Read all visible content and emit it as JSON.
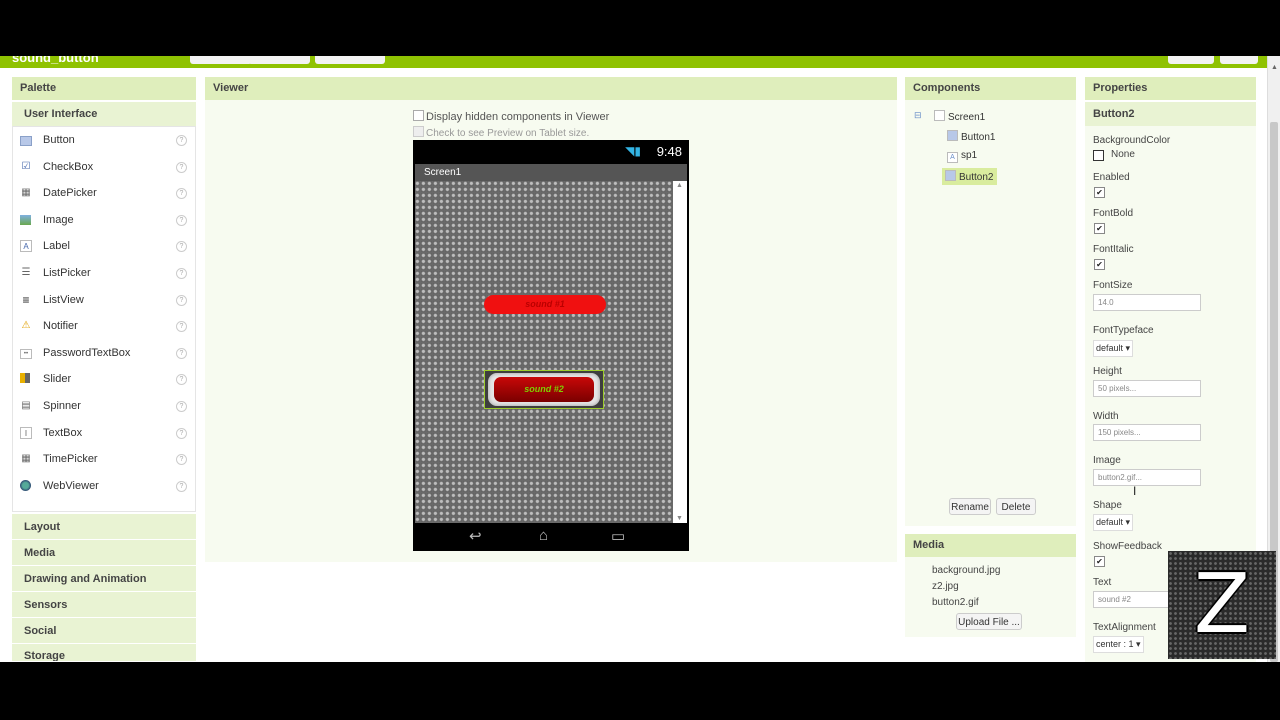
{
  "project": {
    "name": "sound_button"
  },
  "palette": {
    "header": "Palette",
    "section": "User Interface",
    "items": [
      {
        "label": "Button",
        "icon": "button-icon"
      },
      {
        "label": "CheckBox",
        "icon": "checkbox-icon"
      },
      {
        "label": "DatePicker",
        "icon": "datepicker-icon"
      },
      {
        "label": "Image",
        "icon": "image-icon"
      },
      {
        "label": "Label",
        "icon": "label-icon"
      },
      {
        "label": "ListPicker",
        "icon": "listpicker-icon"
      },
      {
        "label": "ListView",
        "icon": "listview-icon"
      },
      {
        "label": "Notifier",
        "icon": "notifier-icon"
      },
      {
        "label": "PasswordTextBox",
        "icon": "passwordtextbox-icon"
      },
      {
        "label": "Slider",
        "icon": "slider-icon"
      },
      {
        "label": "Spinner",
        "icon": "spinner-icon"
      },
      {
        "label": "TextBox",
        "icon": "textbox-icon"
      },
      {
        "label": "TimePicker",
        "icon": "timepicker-icon"
      },
      {
        "label": "WebViewer",
        "icon": "webviewer-icon"
      }
    ],
    "help_glyph": "?",
    "categories": [
      "Layout",
      "Media",
      "Drawing and Animation",
      "Sensors",
      "Social",
      "Storage"
    ]
  },
  "viewer": {
    "header": "Viewer",
    "show_hidden_label": "Display hidden components in Viewer",
    "tablet_preview_label": "Check to see Preview on Tablet size.",
    "phone": {
      "time": "9:48",
      "screen_title": "Screen1",
      "button1_text": "sound #1",
      "button2_text": "sound #2"
    }
  },
  "components": {
    "header": "Components",
    "collapse_glyph": "⊟",
    "tree": {
      "root": "Screen1",
      "children": [
        "Button1",
        "sp1",
        "Button2"
      ],
      "selected": "Button2"
    },
    "rename_label": "Rename",
    "delete_label": "Delete"
  },
  "media": {
    "header": "Media",
    "files": [
      "background.jpg",
      "z2.jpg",
      "button2.gif"
    ],
    "upload_label": "Upload File ..."
  },
  "properties": {
    "header": "Properties",
    "component": "Button2",
    "background_color": {
      "label": "BackgroundColor",
      "value": "None"
    },
    "enabled": {
      "label": "Enabled",
      "checked": true
    },
    "font_bold": {
      "label": "FontBold",
      "checked": true
    },
    "font_italic": {
      "label": "FontItalic",
      "checked": true
    },
    "font_size": {
      "label": "FontSize",
      "value": "14.0"
    },
    "font_typeface": {
      "label": "FontTypeface",
      "value": "default"
    },
    "height": {
      "label": "Height",
      "value": "50 pixels..."
    },
    "width": {
      "label": "Width",
      "value": "150 pixels..."
    },
    "image": {
      "label": "Image",
      "value": "button2.gif..."
    },
    "shape": {
      "label": "Shape",
      "value": "default"
    },
    "show_feedback": {
      "label": "ShowFeedback",
      "checked": true
    },
    "text": {
      "label": "Text",
      "value": "sound #2"
    },
    "text_alignment": {
      "label": "TextAlignment",
      "value": "center : 1"
    },
    "check_glyph": "✔",
    "dropdown_glyph": "▾"
  },
  "overlay": {
    "logo_letter": "Z"
  },
  "colors": {
    "accent": "#8fc202",
    "panel_header": "#dfeebc",
    "selected": "#d9ec9e"
  }
}
